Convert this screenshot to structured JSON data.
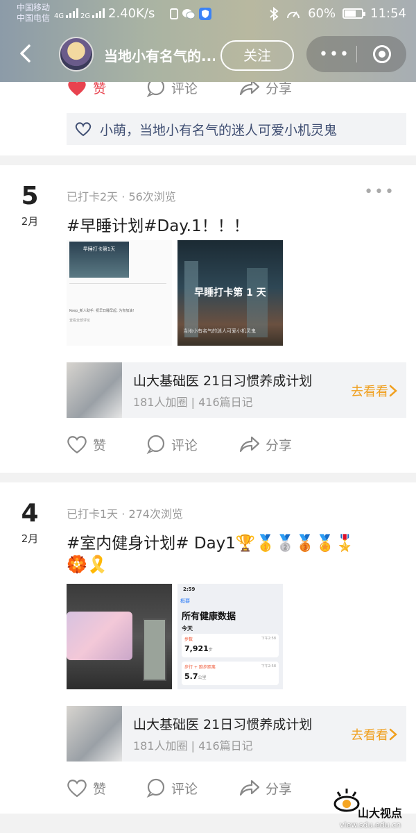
{
  "status": {
    "carrier1": "中国移动",
    "carrier2": "中国电信",
    "sig1": "4G",
    "sig2": "2G",
    "speed": "2.40K/s",
    "battery": "60%",
    "battery_level": 0.6,
    "time": "11:54"
  },
  "nav": {
    "title": "当地小有名气的...",
    "follow": "关注"
  },
  "card0": {
    "like": "赞",
    "comment": "评论",
    "share": "分享",
    "likers": "小萌，当地小有名气的迷人可爱小机灵鬼"
  },
  "posts": [
    {
      "day": "5",
      "month": "2月",
      "meta": "已打卡2天 · 56次浏览",
      "title": "#早睡计划#Day.1！！！",
      "img1_title": "早睡打卡第1天",
      "img1_caption": "Keep_新人助手: 祝早日睡早起, 为你加油!",
      "img1_more": "查看全部评论",
      "img2_title": "早睡打卡第 1 天",
      "img2_caption": "当地小有名气的迷人可爱小机灵鬼",
      "habit_title": "山大基础医 21日习惯养成计划",
      "habit_sub": "181人加圈 | 416篇日记",
      "habit_go": "去看看",
      "like": "赞",
      "comment": "评论",
      "share": "分享"
    },
    {
      "day": "4",
      "month": "2月",
      "meta": "已打卡1天 · 274次浏览",
      "title": "#室内健身计划# Day1🏆🥇🥈🥉🏅🎖️",
      "title_line2": "🏵️🎗️",
      "img2_time": "2:59",
      "img2_back": "概要",
      "img2_heading": "所有健康数据",
      "img2_today": "今天",
      "img2_steps_label": "步数",
      "img2_steps": "7,921",
      "img2_steps_unit": "步",
      "img2_dist_label": "步行 + 跑步距离",
      "img2_dist": "5.7",
      "img2_dist_unit": "公里",
      "img2_row_time": "下午2:58",
      "habit_title": "山大基础医 21日习惯养成计划",
      "habit_sub": "181人加圈 | 416篇日记",
      "habit_go": "去看看",
      "like": "赞",
      "comment": "评论",
      "share": "分享"
    }
  ],
  "watermark": {
    "name": "山大视点",
    "url": "view.sdu.edu.cn"
  },
  "colors": {
    "accent_orange": "#f0a020",
    "like_red": "#e8434f",
    "likers_blue": "#3f4e72"
  }
}
